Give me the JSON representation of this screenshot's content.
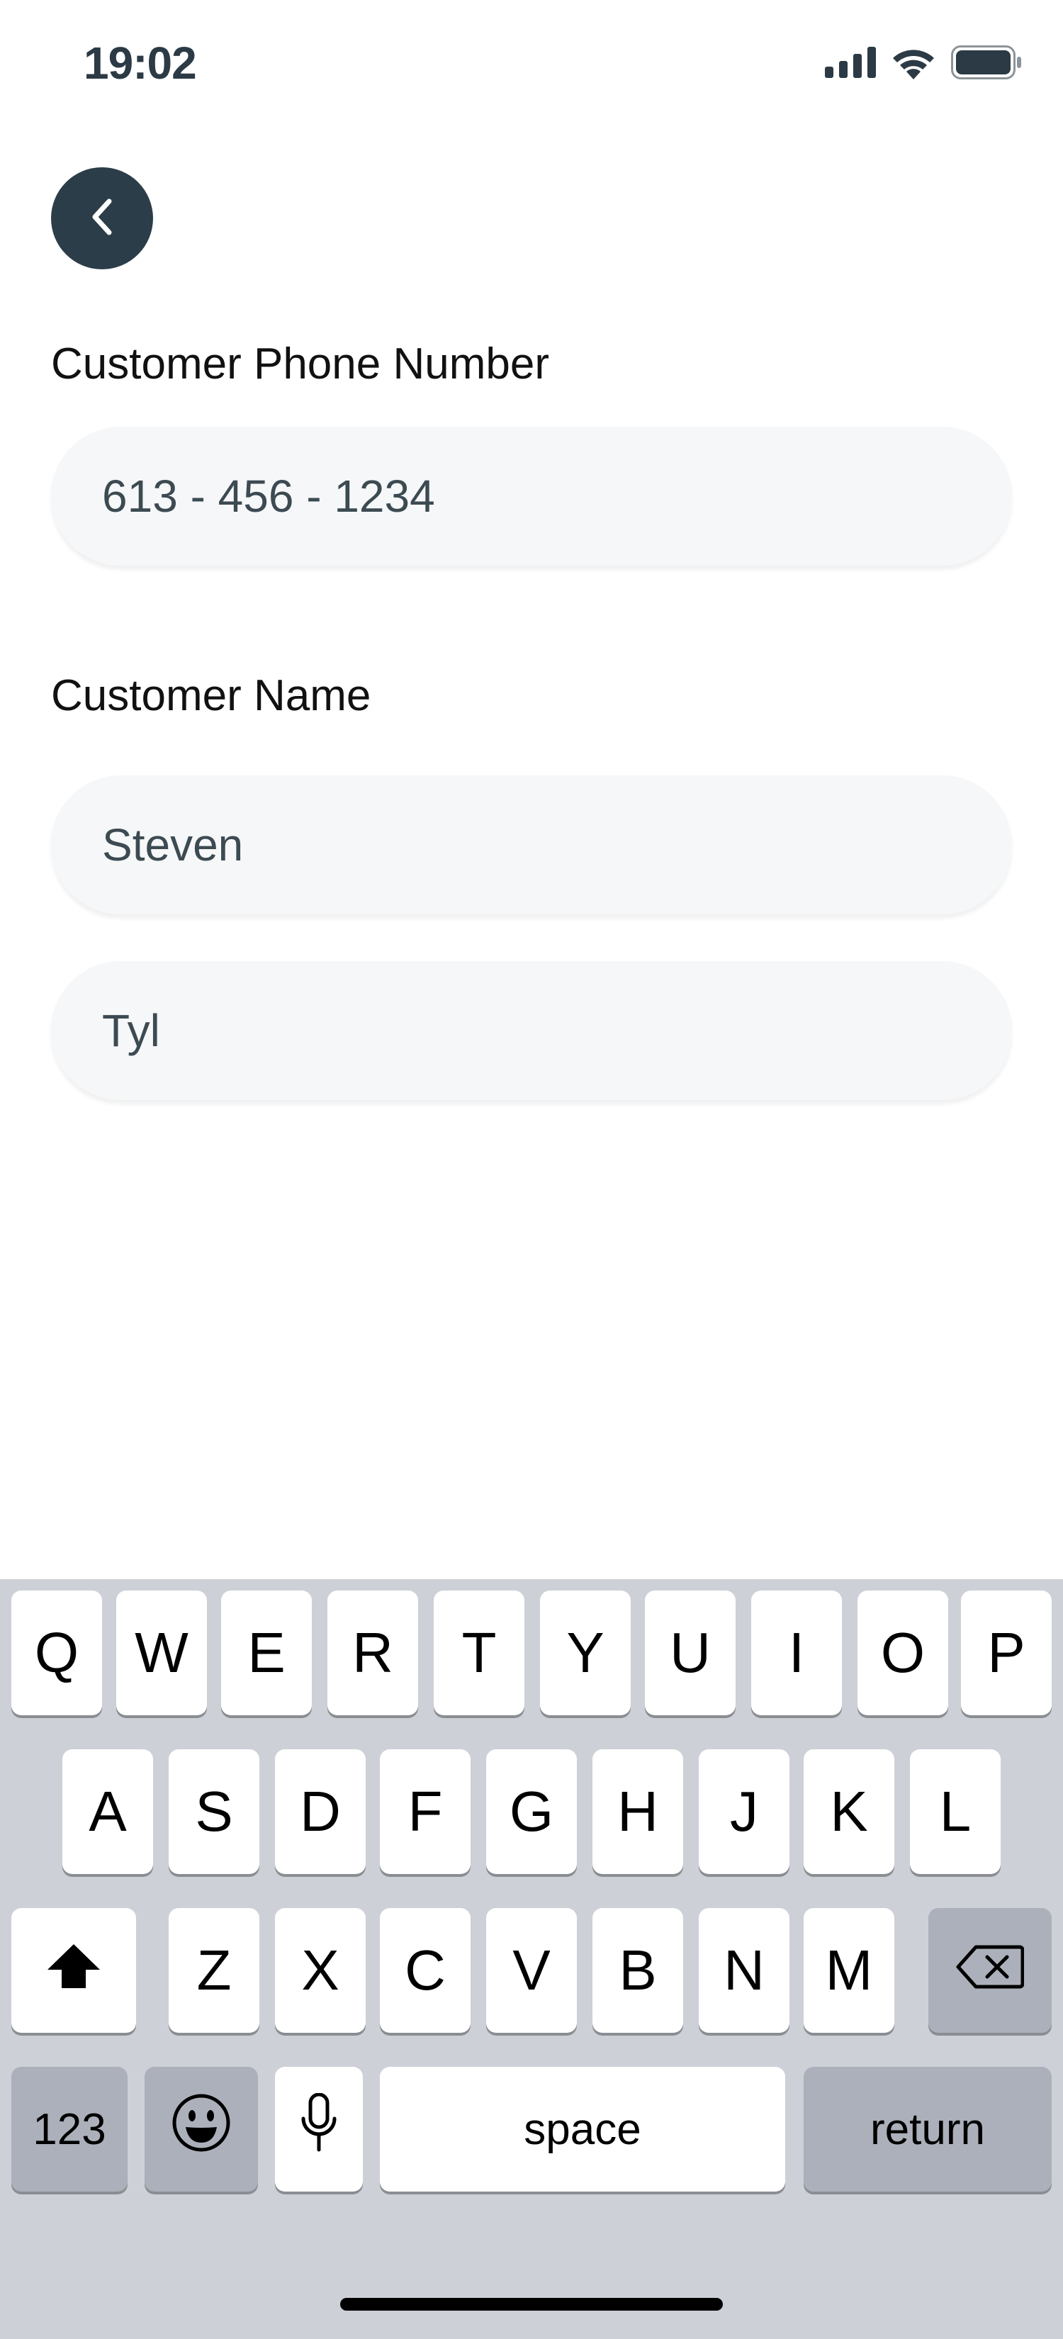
{
  "status_bar": {
    "time": "19:02",
    "icons": [
      "cellular-signal-icon",
      "wifi-icon",
      "battery-icon"
    ]
  },
  "back_button": {
    "icon": "chevron-left-icon"
  },
  "form": {
    "phone_label": "Customer Phone Number",
    "phone_value": "613 - 456 - 1234",
    "name_label": "Customer Name",
    "first_name_value": "Steven",
    "last_name_value": "Tyl"
  },
  "keyboard": {
    "row1": [
      "Q",
      "W",
      "E",
      "R",
      "T",
      "Y",
      "U",
      "I",
      "O",
      "P"
    ],
    "row2": [
      "A",
      "S",
      "D",
      "F",
      "G",
      "H",
      "J",
      "K",
      "L"
    ],
    "row3": [
      "Z",
      "X",
      "C",
      "V",
      "B",
      "N",
      "M"
    ],
    "shift_icon": "shift-arrow-icon",
    "delete_icon": "backspace-icon",
    "numbers_label": "123",
    "emoji_icon": "emoji-icon",
    "dictation_icon": "microphone-icon",
    "space_label": "space",
    "return_label": "return"
  },
  "colors": {
    "accent": "#2b3d48",
    "field_bg": "#f6f7f8",
    "keyboard_bg": "#cdd0d6",
    "dark_key": "#abb0ba"
  }
}
